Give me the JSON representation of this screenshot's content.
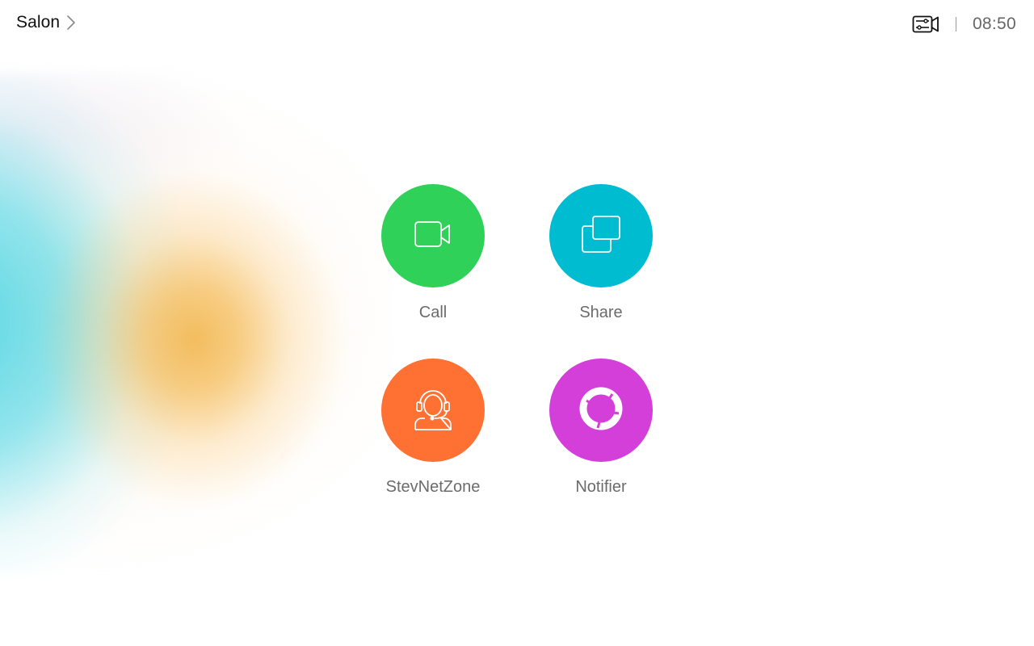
{
  "header": {
    "room_name": "Salon",
    "clock": "08:50",
    "icons": {
      "room_chevron": "chevron-right-icon",
      "camera_control": "camera-control-icon"
    }
  },
  "tiles": [
    {
      "label": "Call",
      "icon": "video-camera-icon",
      "color": "#30D158"
    },
    {
      "label": "Share",
      "icon": "share-screen-icon",
      "color": "#00BCD0"
    },
    {
      "label": "StevNetZone",
      "icon": "headset-agent-icon",
      "color": "#FF7033"
    },
    {
      "label": "Notifier",
      "icon": "ring-logo-icon",
      "color": "#D33FD8"
    }
  ],
  "background": {
    "glow_colors": [
      "#F2B955",
      "#50D6E4"
    ]
  }
}
